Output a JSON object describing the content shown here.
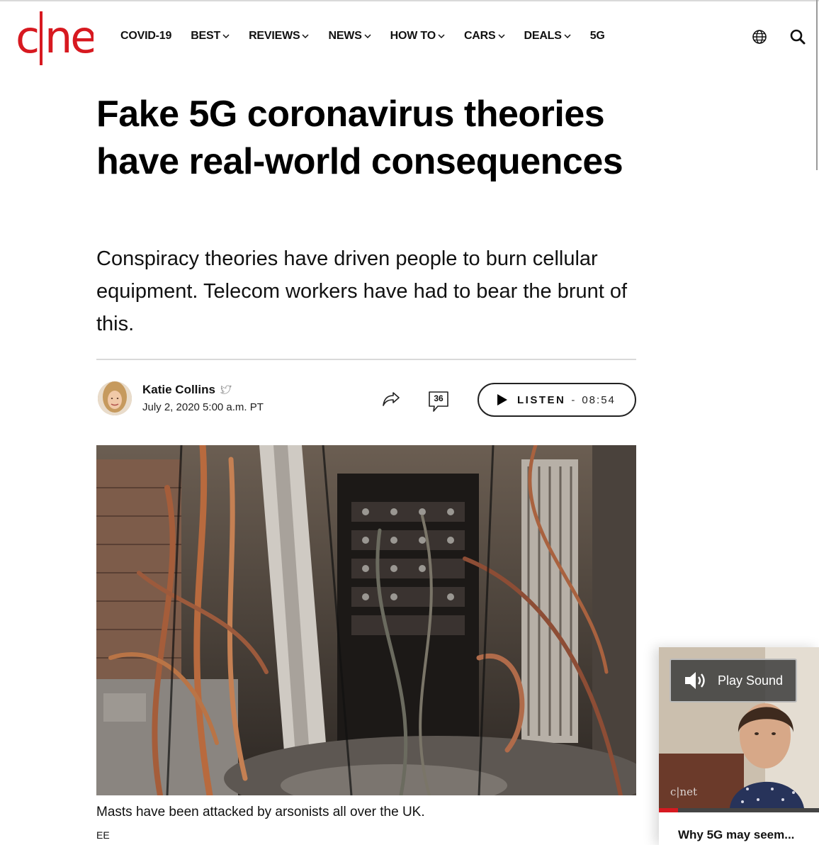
{
  "header": {
    "logo_text": "c|net",
    "nav": [
      {
        "label": "COVID-19",
        "dropdown": false
      },
      {
        "label": "BEST",
        "dropdown": true
      },
      {
        "label": "REVIEWS",
        "dropdown": true
      },
      {
        "label": "NEWS",
        "dropdown": true
      },
      {
        "label": "HOW TO",
        "dropdown": true
      },
      {
        "label": "CARS",
        "dropdown": true
      },
      {
        "label": "DEALS",
        "dropdown": true
      },
      {
        "label": "5G",
        "dropdown": false
      }
    ],
    "icons": [
      "globe-icon",
      "search-icon"
    ]
  },
  "article": {
    "title": "Fake 5G coronavirus theories have real-world consequences",
    "dek": "Conspiracy theories have driven people to burn cellular equipment. Telecom workers have had to bear the brunt of this.",
    "author": "Katie Collins",
    "date": "July 2, 2020 5:00 a.m. PT",
    "comment_count": "36",
    "listen_label": "LISTEN",
    "listen_separator": "-",
    "listen_duration": "08:54",
    "image_caption": "Masts have been attacked by arsonists all over the UK.",
    "image_credit": "EE"
  },
  "video": {
    "play_sound_label": "Play Sound",
    "title": "Why 5G may seem...",
    "watermark": "c|net",
    "progress": 0.12
  },
  "colors": {
    "brand_red": "#d71920",
    "text": "#000000",
    "rule": "#d9d9d9"
  }
}
